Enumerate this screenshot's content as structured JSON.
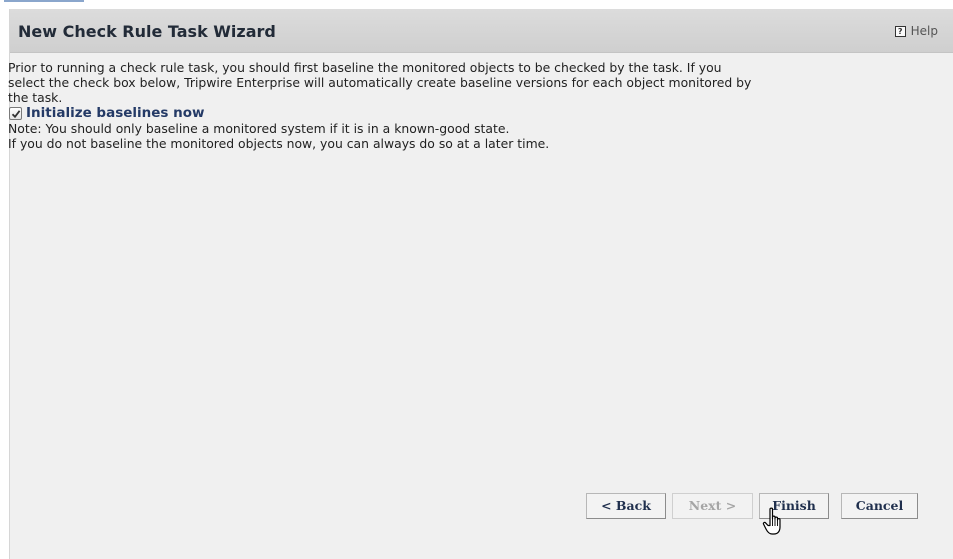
{
  "wizard": {
    "title": "New Check Rule Task Wizard",
    "help_label": "Help",
    "intro_line1": "Prior to running a check rule task, you should first baseline the monitored objects to be checked by the task. If you",
    "intro_line2": "select the check box below, Tripwire Enterprise will automatically create baseline versions for each object monitored by",
    "intro_line3": "the task.",
    "checkbox": {
      "label": "Initialize baselines now",
      "checked": true
    },
    "note_line1": "Note: You should only baseline a monitored system if it is in a known-good state.",
    "note_line2": "If you do not baseline the monitored objects now, you can always do so at a later time."
  },
  "buttons": {
    "back": "< Back",
    "next": "Next >",
    "finish": "Finish",
    "cancel": "Cancel"
  },
  "icons": {
    "help": "help-icon",
    "checkmark": "checkmark-icon",
    "cursor": "hand-pointer-icon"
  }
}
